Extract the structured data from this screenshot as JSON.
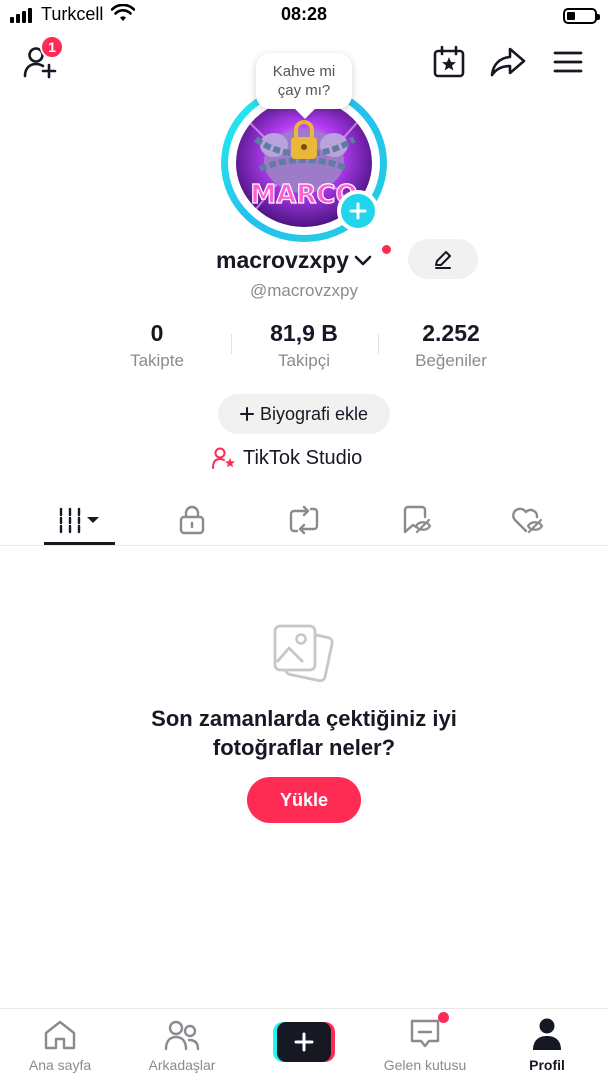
{
  "status_bar": {
    "carrier": "Turkcell",
    "time": "08:28"
  },
  "header": {
    "friend_requests_badge": "1"
  },
  "profile": {
    "bubble_text": "Kahve mi\nçay mı?",
    "avatar_text": "MARCO",
    "username": "macrovzxpy",
    "handle": "@macrovzxpy",
    "stats": [
      {
        "value": "0",
        "label": "Takipte"
      },
      {
        "value": "81,9 B",
        "label": "Takipçi"
      },
      {
        "value": "2.252",
        "label": "Beğeniler"
      }
    ],
    "bio_button": "Biyografi ekle",
    "studio_link": "TikTok Studio"
  },
  "tabs": [
    "videos-grid",
    "private",
    "reposts",
    "favorites",
    "liked"
  ],
  "empty_state": {
    "line1": "Son zamanlarda çektiğiniz iyi",
    "line2": "fotoğraflar neler?",
    "button": "Yükle"
  },
  "bottom_nav": {
    "home": "Ana sayfa",
    "friends": "Arkadaşlar",
    "inbox": "Gelen kutusu",
    "profile": "Profil"
  },
  "colors": {
    "accent": "#fe2c55",
    "cyan": "#25f4ee",
    "text": "#161823",
    "muted": "#8a8b91"
  }
}
